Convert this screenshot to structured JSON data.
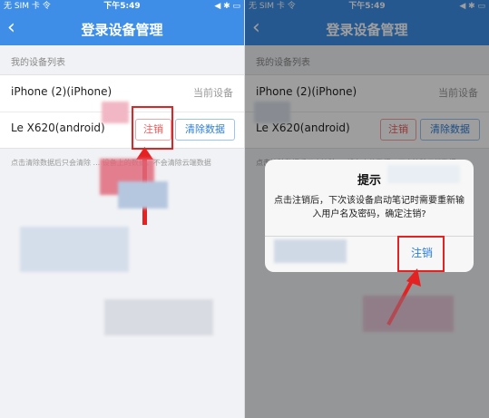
{
  "status": {
    "carrier": "无 SIM 卡 令",
    "time": "下午5:49",
    "right": "◀ ✱ ▭"
  },
  "navbar": {
    "back_glyph": "‹",
    "title": "登录设备管理"
  },
  "device_list": {
    "section_label": "我的设备列表",
    "devices": [
      {
        "name": "iPhone (2)(iPhone)",
        "tag": "当前设备"
      },
      {
        "name": "Le X620(android)",
        "logout_label": "注销",
        "clear_label": "清除数据"
      }
    ]
  },
  "hint": "点击清除数据后只会清除 ... 设备上的数据，不会清除云端数据",
  "dialog": {
    "title": "提示",
    "message": "点击注销后，下次该设备启动笔记时需要重新输入用户名及密码，确定注销?",
    "confirm_label": "注销"
  },
  "colors": {
    "primary": "#3e8ee8",
    "danger": "#ee5a5a",
    "annotation": "#e52222"
  }
}
